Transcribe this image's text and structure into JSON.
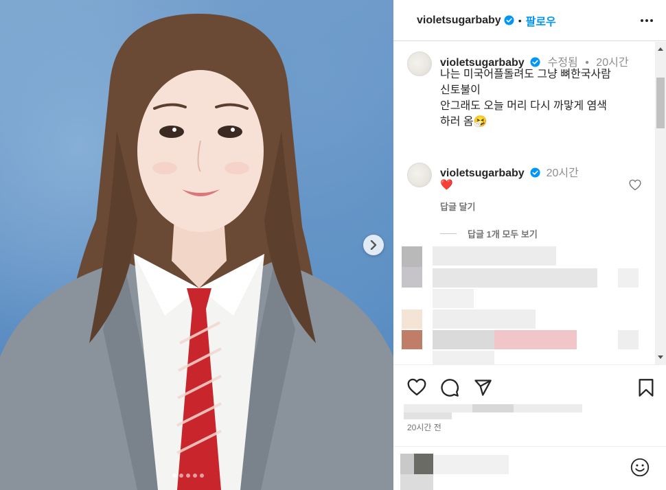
{
  "post": {
    "username": "violetsugarbaby",
    "follow_label": "팔로우",
    "separator": "•",
    "carousel": {
      "slide_count": 5,
      "active_index": 0
    }
  },
  "caption": {
    "username": "violetsugarbaby",
    "edited_label": "수정됨",
    "dot": "•",
    "time": "20시간",
    "lines": [
      "나는 미국어플돌려도 그냥 뼈한국사람",
      "신토불이",
      "안그래도 오늘 머리 다시 까맣게 염색",
      "하러 옴🤧"
    ]
  },
  "comment": {
    "username": "violetsugarbaby",
    "time": "20시간",
    "text": "❤️",
    "reply_label": "답글 달기",
    "view_replies_label": "답글 1개 모두 보기"
  },
  "footer": {
    "time_ago": "20시간 전"
  },
  "icons": {
    "verified": "verified-badge-icon",
    "more": "more-options-icon",
    "like": "heart-icon",
    "comment": "comment-icon",
    "share": "send-icon",
    "save": "bookmark-icon",
    "emoji": "emoji-icon",
    "next": "chevron-right-icon"
  },
  "colors": {
    "accent": "#0095f6",
    "like_red": "#ed4956",
    "muted": "#737373"
  }
}
